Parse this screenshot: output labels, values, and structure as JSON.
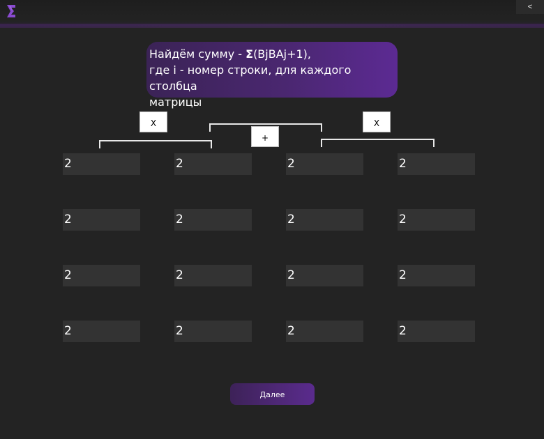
{
  "app": {
    "logo_icon": "sigma-logo-icon"
  },
  "topbar": {
    "back_label": "<"
  },
  "task": {
    "line1_prefix": "Найдём сумму - ",
    "sigma": "Σ",
    "line1_suffix": "(BjBAj+1),",
    "line2": "где i - номер строки, для каждого столбца",
    "line3": "матрицы"
  },
  "operators": {
    "left_multiply": "X",
    "center_plus": "+",
    "right_multiply": "X"
  },
  "matrix": {
    "rows": [
      [
        "2",
        "2",
        "2",
        "2"
      ],
      [
        "2",
        "2",
        "2",
        "2"
      ],
      [
        "2",
        "2",
        "2",
        "2"
      ],
      [
        "2",
        "2",
        "2",
        "2"
      ]
    ]
  },
  "footer": {
    "next_label": "Далее"
  },
  "colors": {
    "background": "#232323",
    "accent": "#5c2a93",
    "cell_background": "#333333"
  }
}
